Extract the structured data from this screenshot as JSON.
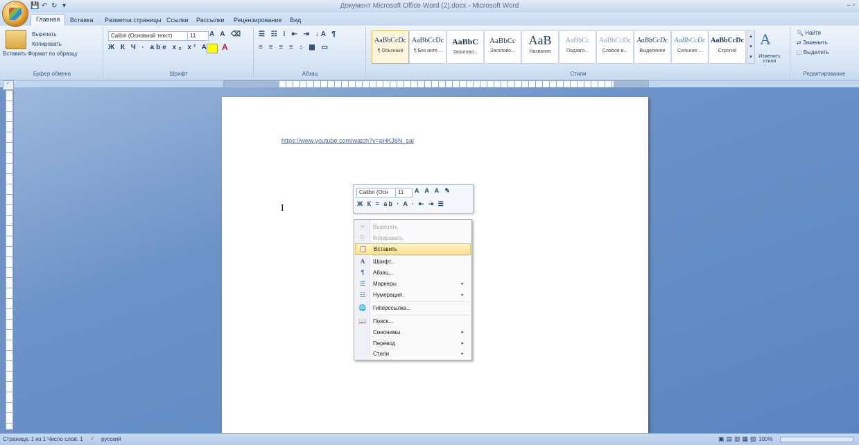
{
  "qat": {
    "items": [
      "💾",
      "↶",
      "↻",
      "▾"
    ]
  },
  "window": {
    "title": "Документ Microsoft Office Word (2).docx - Microsoft Word",
    "controls": "–  ▫"
  },
  "tabs": [
    "Главная",
    "Вставка",
    "Разметка страницы",
    "Ссылки",
    "Рассылки",
    "Рецензирование",
    "Вид"
  ],
  "ribbon": {
    "clipboard": {
      "paste": "Вставить",
      "cut": "Вырезать",
      "copy": "Копировать",
      "format_painter": "Формат по образцу",
      "label": "Буфер обмена"
    },
    "font": {
      "name": "Calibri (Основной текст)",
      "size": "11",
      "label": "Шрифт",
      "row2": "Ж К Ч · abe x₂ x² Aa"
    },
    "paragraph": {
      "label": "Абзац",
      "row1": "☰ ☷ ⁝ ⇤ ⇥ ↓A ¶",
      "row2": "≡ ≡ ≡ ≡ ↕ ▦ ▭"
    },
    "styles": {
      "label": "Стили",
      "items": [
        {
          "sample": "AaBbCcDc",
          "name": "¶ Обычный"
        },
        {
          "sample": "AaBbCcDc",
          "name": "¶ Без инте..."
        },
        {
          "sample": "AaBbC",
          "name": "Заголово..."
        },
        {
          "sample": "AaBbCc",
          "name": "Заголово..."
        },
        {
          "sample": "AaB",
          "name": "Название"
        },
        {
          "sample": "AaBbCc",
          "name": "Подзаго..."
        },
        {
          "sample": "AaBbCcDc",
          "name": "Слабое в..."
        },
        {
          "sample": "AaBbCcDc",
          "name": "Выделение"
        },
        {
          "sample": "AaBbCcDc",
          "name": "Сильное ..."
        },
        {
          "sample": "AaBbCcDc",
          "name": "Строгий"
        }
      ],
      "change_styles": "Изменить стили"
    },
    "editing": {
      "find": "Найти",
      "replace": "Заменить",
      "select": "Выделить",
      "label": "Редактирование"
    }
  },
  "document": {
    "link": "https://www.youtube.com/watch?v=pHKJ6N_sal"
  },
  "mini_toolbar": {
    "font": "Calibri (Осн",
    "size": "11",
    "row1_tail": "A A A ✎",
    "row2": "Ж К ≡ ab · A · ⇤ ⇥ ☰"
  },
  "context_menu": {
    "items": [
      {
        "label": "Вырезать",
        "icon": "✂",
        "disabled": true
      },
      {
        "label": "Копировать",
        "icon": "⎘",
        "disabled": true
      },
      {
        "label": "Вставить",
        "icon": "📋",
        "highlighted": true
      },
      {
        "label": "Шрифт...",
        "icon": "A"
      },
      {
        "label": "Абзац...",
        "icon": "¶"
      },
      {
        "label": "Маркеры",
        "icon": "☰",
        "submenu": true
      },
      {
        "label": "Нумерация",
        "icon": "☷",
        "submenu": true
      },
      {
        "label": "Гиперссылка...",
        "icon": "🌐"
      },
      {
        "label": "Поиск...",
        "icon": "📖"
      },
      {
        "label": "Синонимы",
        "submenu": true
      },
      {
        "label": "Перевод",
        "submenu": true
      },
      {
        "label": "Стили",
        "submenu": true
      }
    ]
  },
  "status": {
    "page": "Страница: 1 из 1",
    "words": "Число слов: 1",
    "language": "русский",
    "zoom": "100%"
  },
  "colors": {
    "accent": "#e0b24a",
    "link": "#3366cc",
    "workspace": "#6e92c6"
  }
}
